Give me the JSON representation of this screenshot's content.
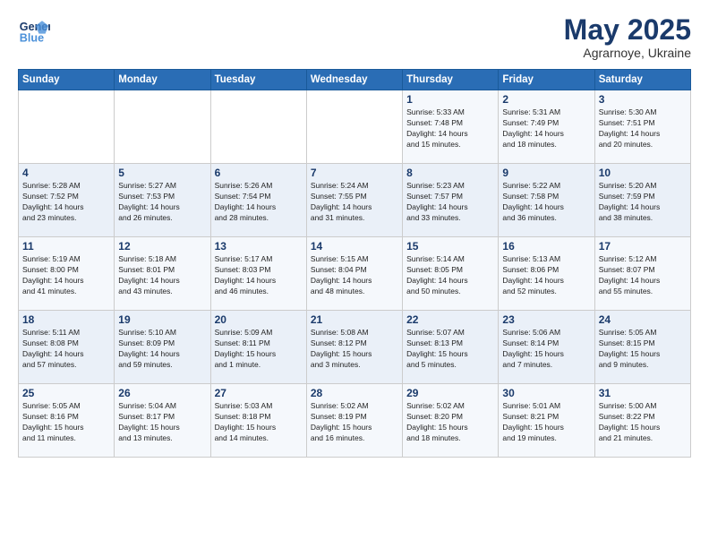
{
  "header": {
    "logo_line1": "General",
    "logo_line2": "Blue",
    "month_year": "May 2025",
    "location": "Agrarnoye, Ukraine"
  },
  "days_of_week": [
    "Sunday",
    "Monday",
    "Tuesday",
    "Wednesday",
    "Thursday",
    "Friday",
    "Saturday"
  ],
  "weeks": [
    [
      {
        "num": "",
        "lines": []
      },
      {
        "num": "",
        "lines": []
      },
      {
        "num": "",
        "lines": []
      },
      {
        "num": "",
        "lines": []
      },
      {
        "num": "1",
        "lines": [
          "Sunrise: 5:33 AM",
          "Sunset: 7:48 PM",
          "Daylight: 14 hours",
          "and 15 minutes."
        ]
      },
      {
        "num": "2",
        "lines": [
          "Sunrise: 5:31 AM",
          "Sunset: 7:49 PM",
          "Daylight: 14 hours",
          "and 18 minutes."
        ]
      },
      {
        "num": "3",
        "lines": [
          "Sunrise: 5:30 AM",
          "Sunset: 7:51 PM",
          "Daylight: 14 hours",
          "and 20 minutes."
        ]
      }
    ],
    [
      {
        "num": "4",
        "lines": [
          "Sunrise: 5:28 AM",
          "Sunset: 7:52 PM",
          "Daylight: 14 hours",
          "and 23 minutes."
        ]
      },
      {
        "num": "5",
        "lines": [
          "Sunrise: 5:27 AM",
          "Sunset: 7:53 PM",
          "Daylight: 14 hours",
          "and 26 minutes."
        ]
      },
      {
        "num": "6",
        "lines": [
          "Sunrise: 5:26 AM",
          "Sunset: 7:54 PM",
          "Daylight: 14 hours",
          "and 28 minutes."
        ]
      },
      {
        "num": "7",
        "lines": [
          "Sunrise: 5:24 AM",
          "Sunset: 7:55 PM",
          "Daylight: 14 hours",
          "and 31 minutes."
        ]
      },
      {
        "num": "8",
        "lines": [
          "Sunrise: 5:23 AM",
          "Sunset: 7:57 PM",
          "Daylight: 14 hours",
          "and 33 minutes."
        ]
      },
      {
        "num": "9",
        "lines": [
          "Sunrise: 5:22 AM",
          "Sunset: 7:58 PM",
          "Daylight: 14 hours",
          "and 36 minutes."
        ]
      },
      {
        "num": "10",
        "lines": [
          "Sunrise: 5:20 AM",
          "Sunset: 7:59 PM",
          "Daylight: 14 hours",
          "and 38 minutes."
        ]
      }
    ],
    [
      {
        "num": "11",
        "lines": [
          "Sunrise: 5:19 AM",
          "Sunset: 8:00 PM",
          "Daylight: 14 hours",
          "and 41 minutes."
        ]
      },
      {
        "num": "12",
        "lines": [
          "Sunrise: 5:18 AM",
          "Sunset: 8:01 PM",
          "Daylight: 14 hours",
          "and 43 minutes."
        ]
      },
      {
        "num": "13",
        "lines": [
          "Sunrise: 5:17 AM",
          "Sunset: 8:03 PM",
          "Daylight: 14 hours",
          "and 46 minutes."
        ]
      },
      {
        "num": "14",
        "lines": [
          "Sunrise: 5:15 AM",
          "Sunset: 8:04 PM",
          "Daylight: 14 hours",
          "and 48 minutes."
        ]
      },
      {
        "num": "15",
        "lines": [
          "Sunrise: 5:14 AM",
          "Sunset: 8:05 PM",
          "Daylight: 14 hours",
          "and 50 minutes."
        ]
      },
      {
        "num": "16",
        "lines": [
          "Sunrise: 5:13 AM",
          "Sunset: 8:06 PM",
          "Daylight: 14 hours",
          "and 52 minutes."
        ]
      },
      {
        "num": "17",
        "lines": [
          "Sunrise: 5:12 AM",
          "Sunset: 8:07 PM",
          "Daylight: 14 hours",
          "and 55 minutes."
        ]
      }
    ],
    [
      {
        "num": "18",
        "lines": [
          "Sunrise: 5:11 AM",
          "Sunset: 8:08 PM",
          "Daylight: 14 hours",
          "and 57 minutes."
        ]
      },
      {
        "num": "19",
        "lines": [
          "Sunrise: 5:10 AM",
          "Sunset: 8:09 PM",
          "Daylight: 14 hours",
          "and 59 minutes."
        ]
      },
      {
        "num": "20",
        "lines": [
          "Sunrise: 5:09 AM",
          "Sunset: 8:11 PM",
          "Daylight: 15 hours",
          "and 1 minute."
        ]
      },
      {
        "num": "21",
        "lines": [
          "Sunrise: 5:08 AM",
          "Sunset: 8:12 PM",
          "Daylight: 15 hours",
          "and 3 minutes."
        ]
      },
      {
        "num": "22",
        "lines": [
          "Sunrise: 5:07 AM",
          "Sunset: 8:13 PM",
          "Daylight: 15 hours",
          "and 5 minutes."
        ]
      },
      {
        "num": "23",
        "lines": [
          "Sunrise: 5:06 AM",
          "Sunset: 8:14 PM",
          "Daylight: 15 hours",
          "and 7 minutes."
        ]
      },
      {
        "num": "24",
        "lines": [
          "Sunrise: 5:05 AM",
          "Sunset: 8:15 PM",
          "Daylight: 15 hours",
          "and 9 minutes."
        ]
      }
    ],
    [
      {
        "num": "25",
        "lines": [
          "Sunrise: 5:05 AM",
          "Sunset: 8:16 PM",
          "Daylight: 15 hours",
          "and 11 minutes."
        ]
      },
      {
        "num": "26",
        "lines": [
          "Sunrise: 5:04 AM",
          "Sunset: 8:17 PM",
          "Daylight: 15 hours",
          "and 13 minutes."
        ]
      },
      {
        "num": "27",
        "lines": [
          "Sunrise: 5:03 AM",
          "Sunset: 8:18 PM",
          "Daylight: 15 hours",
          "and 14 minutes."
        ]
      },
      {
        "num": "28",
        "lines": [
          "Sunrise: 5:02 AM",
          "Sunset: 8:19 PM",
          "Daylight: 15 hours",
          "and 16 minutes."
        ]
      },
      {
        "num": "29",
        "lines": [
          "Sunrise: 5:02 AM",
          "Sunset: 8:20 PM",
          "Daylight: 15 hours",
          "and 18 minutes."
        ]
      },
      {
        "num": "30",
        "lines": [
          "Sunrise: 5:01 AM",
          "Sunset: 8:21 PM",
          "Daylight: 15 hours",
          "and 19 minutes."
        ]
      },
      {
        "num": "31",
        "lines": [
          "Sunrise: 5:00 AM",
          "Sunset: 8:22 PM",
          "Daylight: 15 hours",
          "and 21 minutes."
        ]
      }
    ]
  ]
}
